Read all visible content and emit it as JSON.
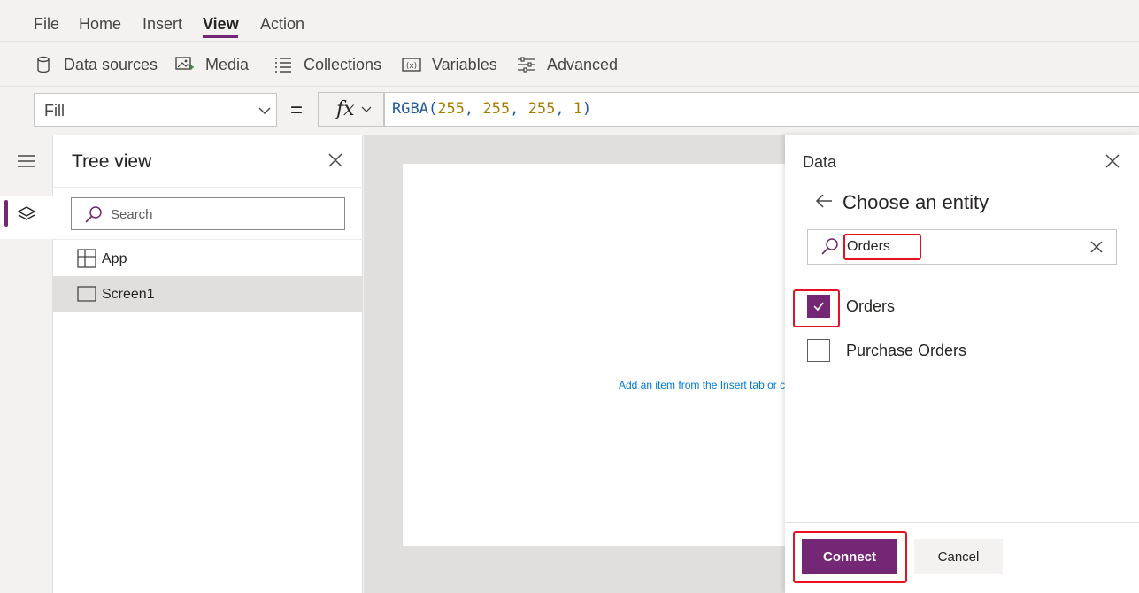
{
  "menu": {
    "items": [
      "File",
      "Home",
      "Insert",
      "View",
      "Action"
    ],
    "active": "View"
  },
  "toolbar": {
    "items": [
      {
        "label": "Data sources",
        "icon": "database-icon"
      },
      {
        "label": "Media",
        "icon": "media-icon"
      },
      {
        "label": "Collections",
        "icon": "collections-icon"
      },
      {
        "label": "Variables",
        "icon": "variables-icon"
      },
      {
        "label": "Advanced",
        "icon": "advanced-settings-icon"
      }
    ]
  },
  "formula_bar": {
    "property": "Fill",
    "fx_label": "fx",
    "formula_fn": "RGBA(",
    "formula_args": [
      "255",
      "255",
      "255",
      "1"
    ],
    "formula_close": ")"
  },
  "tree_view": {
    "title": "Tree view",
    "search_placeholder": "Search",
    "items": [
      {
        "label": "App",
        "icon": "app-icon",
        "selected": false
      },
      {
        "label": "Screen1",
        "icon": "screen-icon",
        "selected": true
      }
    ]
  },
  "canvas": {
    "hint_text": "Add an item from the Insert tab or connect to data"
  },
  "data_panel": {
    "title": "Data",
    "heading": "Choose an entity",
    "search_value": "Orders",
    "options": [
      {
        "label": "Orders",
        "checked": true
      },
      {
        "label": "Purchase Orders",
        "checked": false
      }
    ],
    "connect_label": "Connect",
    "cancel_label": "Cancel"
  },
  "colors": {
    "accent": "#742774",
    "highlight": "#e81123",
    "link": "#0078d4"
  }
}
